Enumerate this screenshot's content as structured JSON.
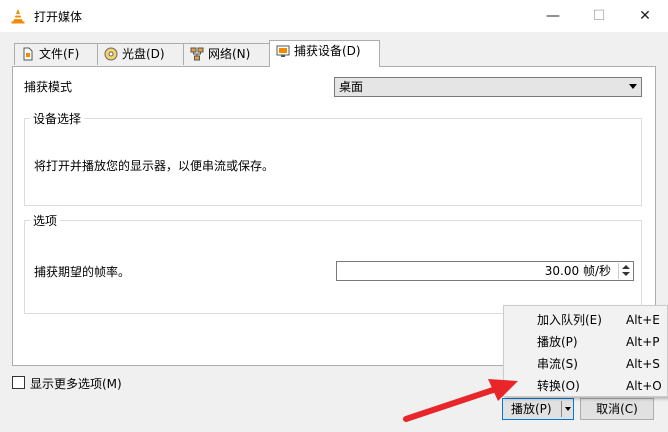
{
  "window": {
    "title": "打开媒体",
    "minimize": "—",
    "maximize": "☐",
    "close": "✕"
  },
  "tabs": [
    {
      "label": "文件(F)",
      "icon": "file-icon"
    },
    {
      "label": "光盘(D)",
      "icon": "disc-icon"
    },
    {
      "label": "网络(N)",
      "icon": "network-icon"
    },
    {
      "label": "捕获设备(D)",
      "icon": "capture-device-icon",
      "active": true
    }
  ],
  "capture": {
    "mode_label": "捕获模式",
    "mode_value": "桌面",
    "device_group_title": "设备选择",
    "device_description": "将打开并播放您的显示器，以便串流或保存。",
    "options_group_title": "选项",
    "framerate_label": "捕获期望的帧率。",
    "framerate_value": "30.00 帧/秒"
  },
  "footer": {
    "more_options_label": "显示更多选项(M)",
    "more_options_checked": false,
    "play_label": "播放(P)",
    "cancel_label": "取消(C)"
  },
  "play_menu": [
    {
      "label": "加入队列(E)",
      "shortcut": "Alt+E"
    },
    {
      "label": "播放(P)",
      "shortcut": "Alt+P"
    },
    {
      "label": "串流(S)",
      "shortcut": "Alt+S"
    },
    {
      "label": "转换(O)",
      "shortcut": "Alt+O"
    }
  ],
  "colors": {
    "vlc_orange": "#f08a00",
    "annotation_red": "#e8262a",
    "focus_blue": "#0078d7"
  }
}
